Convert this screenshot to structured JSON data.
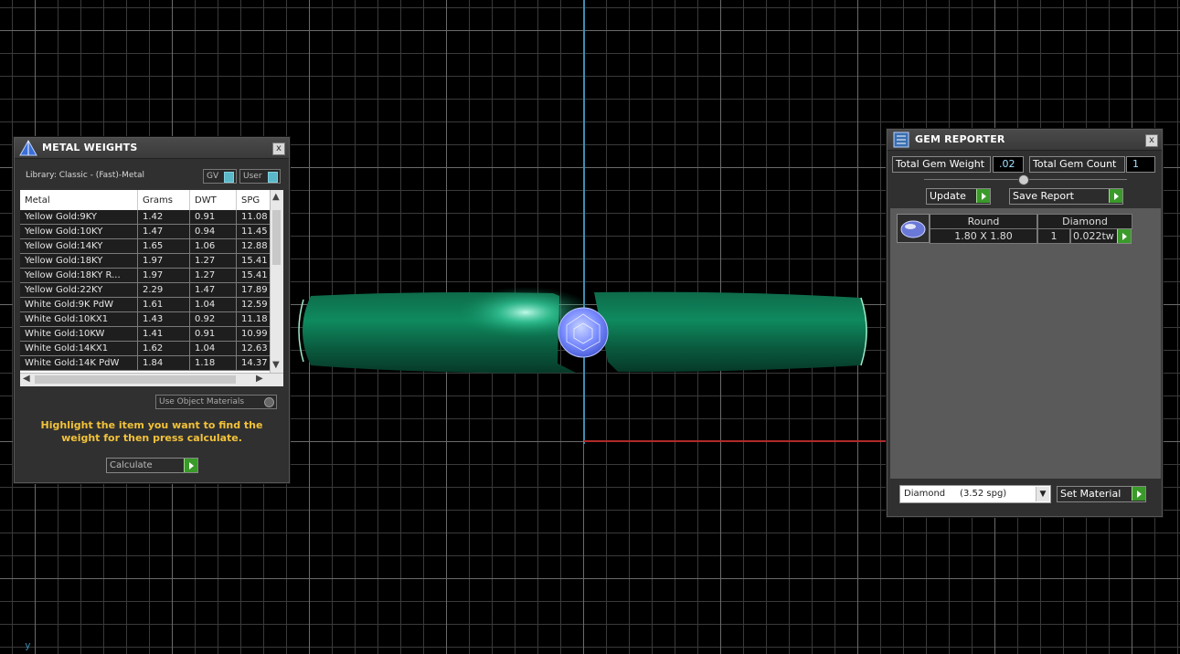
{
  "viewport": {
    "axis_label": "y",
    "colors": {
      "ring": "#0f8a5f",
      "gem": "#7a8cff",
      "axis_y": "#3b8fb0",
      "axis_x": "#b02a2a"
    }
  },
  "metal_weights": {
    "title": "METAL WEIGHTS",
    "close": "x",
    "library": "Library: Classic - (Fast)-Metal",
    "toggle_gv": "GV",
    "toggle_user": "User",
    "columns": [
      "Metal",
      "Grams",
      "DWT",
      "SPG"
    ],
    "rows": [
      [
        "Yellow Gold:9KY",
        "1.42",
        "0.91",
        "11.08"
      ],
      [
        "Yellow Gold:10KY",
        "1.47",
        "0.94",
        "11.45"
      ],
      [
        "Yellow Gold:14KY",
        "1.65",
        "1.06",
        "12.88"
      ],
      [
        "Yellow Gold:18KY",
        "1.97",
        "1.27",
        "15.41"
      ],
      [
        "Yellow Gold:18KY R...",
        "1.97",
        "1.27",
        "15.41"
      ],
      [
        "Yellow Gold:22KY",
        "2.29",
        "1.47",
        "17.89"
      ],
      [
        "White Gold:9K PdW",
        "1.61",
        "1.04",
        "12.59"
      ],
      [
        "White Gold:10KX1",
        "1.43",
        "0.92",
        "11.18"
      ],
      [
        "White Gold:10KW",
        "1.41",
        "0.91",
        "10.99"
      ],
      [
        "White Gold:14KX1",
        "1.62",
        "1.04",
        "12.63"
      ],
      [
        "White Gold:14K PdW",
        "1.84",
        "1.18",
        "14.37"
      ]
    ],
    "use_object_materials": "Use Object Materials",
    "instructions": "Highlight the item you want to find the weight for then press calculate.",
    "calculate": "Calculate"
  },
  "gem_reporter": {
    "title": "GEM REPORTER",
    "close": "x",
    "total_weight_label": "Total Gem Weight",
    "total_weight_value": ".02",
    "total_count_label": "Total Gem Count",
    "total_count_value": "1",
    "update": "Update",
    "save_report": "Save Report",
    "gems": [
      {
        "shape": "Round",
        "material": "Diamond",
        "size": "1.80 X 1.80",
        "count": "1",
        "weight": "0.022tw"
      }
    ],
    "material_select": "Diamond     (3.52 spg)",
    "set_material": "Set Material"
  }
}
